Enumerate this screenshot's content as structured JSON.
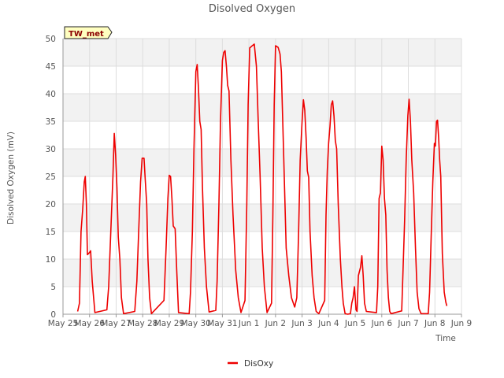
{
  "chart_data": {
    "type": "line",
    "title": "Disolved Oxygen",
    "xlabel": "Time",
    "ylabel": "Disolved Oxygen (mV)",
    "badge": "TW_met",
    "ylim": [
      0,
      50
    ],
    "yticks": [
      0,
      5,
      10,
      15,
      20,
      25,
      30,
      35,
      40,
      45,
      50
    ],
    "xlim": [
      0,
      15
    ],
    "xticks": [
      {
        "x": 0,
        "label": "May 25"
      },
      {
        "x": 1,
        "label": "May 26"
      },
      {
        "x": 2,
        "label": "May 27"
      },
      {
        "x": 3,
        "label": "May 28"
      },
      {
        "x": 4,
        "label": "May 29"
      },
      {
        "x": 5,
        "label": "May 30"
      },
      {
        "x": 6,
        "label": "May 31"
      },
      {
        "x": 7,
        "label": "Jun 1"
      },
      {
        "x": 8,
        "label": "Jun 2"
      },
      {
        "x": 9,
        "label": "Jun 3"
      },
      {
        "x": 10,
        "label": "Jun 4"
      },
      {
        "x": 11,
        "label": "Jun 5"
      },
      {
        "x": 12,
        "label": "Jun 6"
      },
      {
        "x": 13,
        "label": "Jun 7"
      },
      {
        "x": 14,
        "label": "Jun 8"
      },
      {
        "x": 15,
        "label": "Jun 9"
      }
    ],
    "grid": true,
    "legend_position": "bottom-center",
    "colors": {
      "series": "#ee0000",
      "band": "#f2f2f2",
      "grid": "#dddddd",
      "badge_bg": "#ffffc0"
    },
    "series": [
      {
        "name": "DisOxy",
        "points": [
          [
            0.55,
            0.5
          ],
          [
            0.62,
            2
          ],
          [
            0.68,
            15
          ],
          [
            0.74,
            19
          ],
          [
            0.8,
            24
          ],
          [
            0.84,
            25
          ],
          [
            0.88,
            20
          ],
          [
            0.92,
            10.8
          ],
          [
            1.0,
            11.2
          ],
          [
            1.04,
            11.5
          ],
          [
            1.1,
            6
          ],
          [
            1.2,
            0.3
          ],
          [
            1.65,
            0.8
          ],
          [
            1.72,
            5
          ],
          [
            1.8,
            15
          ],
          [
            1.88,
            25
          ],
          [
            1.93,
            32.8
          ],
          [
            1.98,
            29
          ],
          [
            2.03,
            23
          ],
          [
            2.08,
            14
          ],
          [
            2.14,
            10
          ],
          [
            2.2,
            3
          ],
          [
            2.28,
            0.1
          ],
          [
            2.7,
            0.5
          ],
          [
            2.78,
            6
          ],
          [
            2.85,
            15
          ],
          [
            2.92,
            24
          ],
          [
            2.98,
            28.3
          ],
          [
            3.05,
            28.3
          ],
          [
            3.1,
            24
          ],
          [
            3.15,
            20
          ],
          [
            3.2,
            10
          ],
          [
            3.26,
            3
          ],
          [
            3.33,
            0.1
          ],
          [
            3.8,
            2.5
          ],
          [
            3.88,
            12
          ],
          [
            3.95,
            21
          ],
          [
            4.0,
            25.2
          ],
          [
            4.05,
            25
          ],
          [
            4.1,
            21
          ],
          [
            4.15,
            16
          ],
          [
            4.22,
            15.5
          ],
          [
            4.28,
            8
          ],
          [
            4.35,
            0.3
          ],
          [
            4.75,
            0.1
          ],
          [
            4.8,
            4
          ],
          [
            4.87,
            15
          ],
          [
            4.93,
            30
          ],
          [
            5.0,
            44
          ],
          [
            5.05,
            45.3
          ],
          [
            5.1,
            41
          ],
          [
            5.15,
            35
          ],
          [
            5.2,
            33.5
          ],
          [
            5.25,
            23
          ],
          [
            5.32,
            12
          ],
          [
            5.4,
            5
          ],
          [
            5.5,
            0.4
          ],
          [
            5.75,
            0.7
          ],
          [
            5.8,
            6
          ],
          [
            5.87,
            20
          ],
          [
            5.93,
            35
          ],
          [
            6.0,
            46
          ],
          [
            6.05,
            47.5
          ],
          [
            6.1,
            47.8
          ],
          [
            6.15,
            45
          ],
          [
            6.2,
            41.5
          ],
          [
            6.25,
            40.5
          ],
          [
            6.32,
            28
          ],
          [
            6.4,
            18
          ],
          [
            6.5,
            8
          ],
          [
            6.6,
            3
          ],
          [
            6.7,
            0.3
          ],
          [
            6.85,
            2.5
          ],
          [
            6.92,
            20
          ],
          [
            6.97,
            38
          ],
          [
            7.03,
            48.3
          ],
          [
            7.1,
            48.6
          ],
          [
            7.2,
            49
          ],
          [
            7.28,
            45
          ],
          [
            7.35,
            35
          ],
          [
            7.42,
            25
          ],
          [
            7.5,
            12
          ],
          [
            7.58,
            5
          ],
          [
            7.68,
            0.3
          ],
          [
            7.85,
            2
          ],
          [
            7.9,
            18
          ],
          [
            7.95,
            38
          ],
          [
            8.0,
            48.7
          ],
          [
            8.1,
            48.4
          ],
          [
            8.17,
            47.2
          ],
          [
            8.22,
            44
          ],
          [
            8.3,
            30
          ],
          [
            8.4,
            12
          ],
          [
            8.5,
            7
          ],
          [
            8.6,
            3
          ],
          [
            8.72,
            1.3
          ],
          [
            8.8,
            3
          ],
          [
            8.87,
            15
          ],
          [
            8.93,
            28
          ],
          [
            9.0,
            35
          ],
          [
            9.05,
            38.9
          ],
          [
            9.1,
            37
          ],
          [
            9.15,
            32
          ],
          [
            9.2,
            26
          ],
          [
            9.25,
            24.8
          ],
          [
            9.3,
            15
          ],
          [
            9.38,
            7
          ],
          [
            9.45,
            3
          ],
          [
            9.53,
            0.5
          ],
          [
            9.63,
            0.1
          ],
          [
            9.85,
            2.5
          ],
          [
            9.9,
            18
          ],
          [
            9.95,
            26
          ],
          [
            10.0,
            31
          ],
          [
            10.05,
            34
          ],
          [
            10.1,
            38
          ],
          [
            10.15,
            38.7
          ],
          [
            10.2,
            36
          ],
          [
            10.25,
            31.5
          ],
          [
            10.3,
            30
          ],
          [
            10.36,
            20
          ],
          [
            10.44,
            10
          ],
          [
            10.5,
            5
          ],
          [
            10.55,
            2
          ],
          [
            10.62,
            0.1
          ],
          [
            10.72,
            0
          ],
          [
            10.82,
            0.1
          ],
          [
            10.87,
            2
          ],
          [
            10.92,
            3
          ],
          [
            10.97,
            5
          ],
          [
            11.0,
            3
          ],
          [
            11.03,
            0.8
          ],
          [
            11.07,
            0.5
          ],
          [
            11.12,
            7
          ],
          [
            11.2,
            8.5
          ],
          [
            11.25,
            10.6
          ],
          [
            11.3,
            7
          ],
          [
            11.35,
            2
          ],
          [
            11.42,
            0.5
          ],
          [
            11.8,
            0.3
          ],
          [
            11.85,
            5
          ],
          [
            11.9,
            21
          ],
          [
            11.95,
            22
          ],
          [
            12.0,
            30.5
          ],
          [
            12.05,
            28
          ],
          [
            12.1,
            21
          ],
          [
            12.15,
            18
          ],
          [
            12.2,
            8
          ],
          [
            12.25,
            3
          ],
          [
            12.3,
            0.5
          ],
          [
            12.35,
            0.1
          ],
          [
            12.75,
            0.6
          ],
          [
            12.8,
            8
          ],
          [
            12.86,
            17
          ],
          [
            12.92,
            28
          ],
          [
            12.98,
            36
          ],
          [
            13.03,
            39
          ],
          [
            13.08,
            35
          ],
          [
            13.13,
            28
          ],
          [
            13.2,
            22
          ],
          [
            13.27,
            12
          ],
          [
            13.33,
            4
          ],
          [
            13.4,
            1
          ],
          [
            13.48,
            0.1
          ],
          [
            13.75,
            0.1
          ],
          [
            13.8,
            4
          ],
          [
            13.86,
            14
          ],
          [
            13.92,
            24
          ],
          [
            13.98,
            31
          ],
          [
            14.02,
            30.5
          ],
          [
            14.06,
            35
          ],
          [
            14.1,
            35.2
          ],
          [
            14.14,
            32
          ],
          [
            14.18,
            28
          ],
          [
            14.22,
            25
          ],
          [
            14.28,
            11
          ],
          [
            14.35,
            4
          ],
          [
            14.41,
            2.2
          ],
          [
            14.45,
            1.5
          ]
        ]
      }
    ]
  }
}
